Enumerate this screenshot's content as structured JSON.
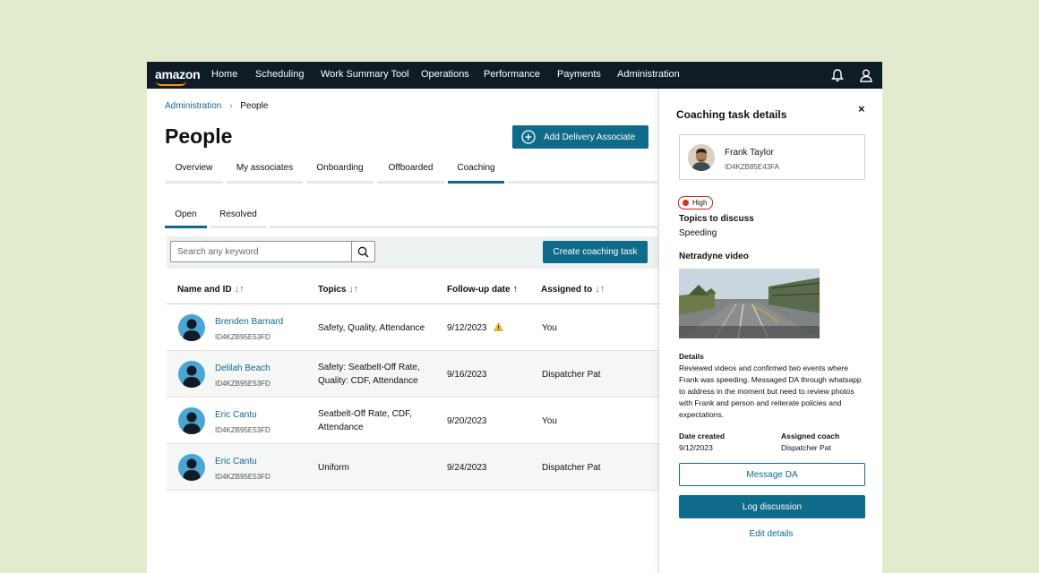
{
  "nav": {
    "logo": "amazon",
    "items": [
      "Home",
      "Scheduling",
      "Work Summary Tool",
      "Operations",
      "Performance",
      "Payments",
      "Administration"
    ]
  },
  "breadcrumb": {
    "parent": "Administration",
    "sep": "›",
    "current": "People"
  },
  "page": {
    "title": "People",
    "add_button": "Add Delivery Associate"
  },
  "tabs": [
    "Overview",
    "My associates",
    "Onboarding",
    "Offboarded",
    "Coaching"
  ],
  "subtabs": [
    "Open",
    "Resolved"
  ],
  "toolbar": {
    "search_placeholder": "Search any keyword",
    "create_button": "Create coaching task"
  },
  "table": {
    "headers": [
      "Name and ID",
      "Topics",
      "Follow-up date",
      "Assigned to"
    ],
    "sort_glyph": "↓↑",
    "sort_active_glyph": "↑",
    "rows": [
      {
        "name": "Brenden Barnard",
        "id": "ID4KZB95E53FD",
        "topics": [
          "Safety, Quality, Attendance"
        ],
        "date": "9/12/2023",
        "assigned": "You"
      },
      {
        "name": "Delilah Beach",
        "id": "ID4KZB95E53FD",
        "topics": [
          "Safety: Seatbelt-Off Rate,",
          "Quality: CDF, Attendance"
        ],
        "date": "9/16/2023",
        "assigned": "Dispatcher Pat"
      },
      {
        "name": "Eric Cantu",
        "id": "ID4KZB95E53FD",
        "topics": [
          "Seatbelt-Off Rate, CDF,",
          "Attendance"
        ],
        "date": "9/20/2023",
        "assigned": "You"
      },
      {
        "name": "Eric Cantu",
        "id": "ID4KZB95E53FD",
        "topics": [
          "Uniform"
        ],
        "date": "9/24/2023",
        "assigned": "Dispatcher Pat"
      }
    ]
  },
  "panel": {
    "title": "Coaching task details",
    "close_glyph": "×",
    "person": {
      "name": "Frank Taylor",
      "id": "ID4KZB85E43FA"
    },
    "priority": "High",
    "topics_label": "Topics to discuss",
    "topics_value": "Speeding",
    "video_label": "Netradyne video",
    "details_label": "Details",
    "details_text": "Reviewed videos and confirmed two events where Frank was speeding. Messaged DA through whatsapp to address in the moment but need to review photos with Frank and person and reiterate policies and expectations.",
    "date_created_label": "Date created",
    "date_created": "9/12/2023",
    "coach_label": "Assigned coach",
    "coach": "Dispatcher Pat",
    "message_button": "Message DA",
    "log_button": "Log discussion",
    "edit_link": "Edit details"
  },
  "colors": {
    "accent": "#0e6b8a",
    "nav_bg": "#0f1c26",
    "high": "#d13212",
    "background": "#e3ebcf"
  }
}
